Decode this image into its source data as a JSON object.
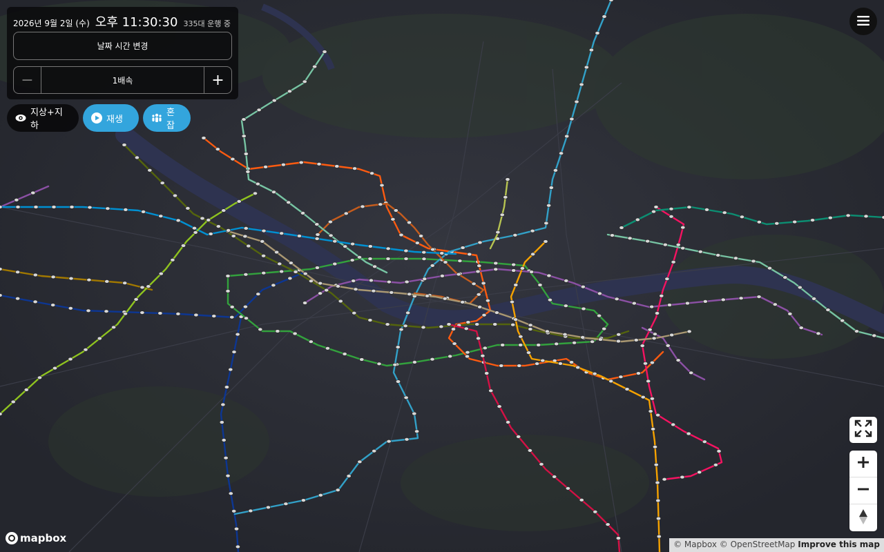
{
  "header": {
    "date": "2026년 9월 2일 (수)",
    "time": "오후 11:30:30",
    "running_count": "335대 운행 중"
  },
  "controls": {
    "change_datetime": "날짜 시간 변경",
    "speed_value": "1배속",
    "speed_minus_icon": "minus-icon",
    "speed_plus_icon": "plus-icon"
  },
  "toolbar": {
    "view_mode": "지상+지하",
    "play": "재생",
    "crowd": "혼잡"
  },
  "map": {
    "logo": "mapbox",
    "attribution": "© Mapbox © OpenStreetMap",
    "improve": "Improve this map",
    "lines": [
      {
        "name": "line-1",
        "color": "#0d3692"
      },
      {
        "name": "line-2",
        "color": "#33a23d"
      },
      {
        "name": "line-3",
        "color": "#fe5b10"
      },
      {
        "name": "line-4",
        "color": "#32a1c8"
      },
      {
        "name": "line-5",
        "color": "#8b50a4"
      },
      {
        "name": "line-6",
        "color": "#c55c1d"
      },
      {
        "name": "line-7",
        "color": "#54640d"
      },
      {
        "name": "line-8",
        "color": "#f51361"
      },
      {
        "name": "line-9",
        "color": "#aa9872"
      },
      {
        "name": "sinbundang",
        "color": "#d31145"
      },
      {
        "name": "suin-bundang",
        "color": "#f5a200"
      },
      {
        "name": "gyeongui-jungang",
        "color": "#77c4a3"
      },
      {
        "name": "gyeongchun",
        "color": "#0c8e72"
      },
      {
        "name": "airport",
        "color": "#0090d2"
      },
      {
        "name": "gimpo-gold",
        "color": "#a17800"
      },
      {
        "name": "ui-sinseol",
        "color": "#b7c452"
      },
      {
        "name": "seohae",
        "color": "#8fc31f"
      }
    ]
  }
}
